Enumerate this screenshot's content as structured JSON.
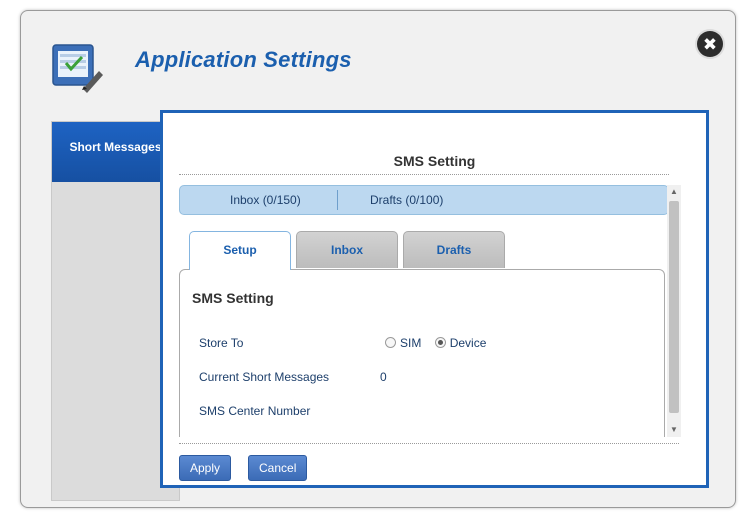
{
  "dialog": {
    "title": "Application Settings",
    "close_label": "✖",
    "icon": "settings-checklist-icon",
    "accent_color": "#1b5fae"
  },
  "nav": {
    "items": [
      {
        "label": "Short Messages",
        "active": true
      }
    ]
  },
  "content": {
    "section_title": "SMS Setting",
    "folders": [
      {
        "label": "Inbox (0/150)"
      },
      {
        "label": "Drafts (0/100)"
      }
    ],
    "tabs": [
      {
        "label": "Setup",
        "active": true
      },
      {
        "label": "Inbox",
        "active": false
      },
      {
        "label": "Drafts",
        "active": false
      }
    ],
    "panel": {
      "title": "SMS Setting",
      "store_to_label": "Store To",
      "store_to_options": [
        {
          "label": "SIM",
          "selected": false
        },
        {
          "label": "Device",
          "selected": true
        }
      ],
      "current_messages_label": "Current Short Messages",
      "current_messages_value": "0",
      "center_number_label": "SMS Center Number"
    },
    "buttons": {
      "apply": "Apply",
      "cancel": "Cancel"
    }
  }
}
